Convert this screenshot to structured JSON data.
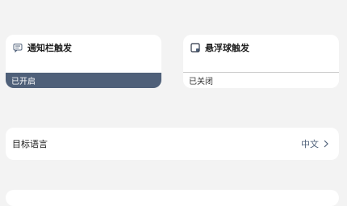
{
  "triggers": {
    "notification": {
      "title": "通知栏触发",
      "icon": "notification-bar-icon",
      "status": "已开启"
    },
    "floating_ball": {
      "title": "悬浮球触发",
      "icon": "floating-ball-icon",
      "status": "已关闭"
    }
  },
  "target_language": {
    "label": "目标语言",
    "value": "中文",
    "icon": "chevron-right-icon"
  },
  "colors": {
    "accent": "#4f6079",
    "background": "#f3f3f3",
    "card": "#ffffff"
  }
}
